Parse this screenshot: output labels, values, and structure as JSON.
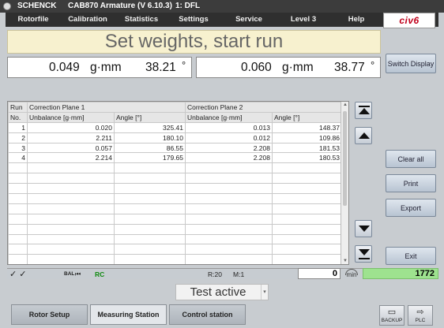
{
  "window": {
    "brand": "SCHENCK",
    "app_title": "CAB870 Armature (V 6.10.3)",
    "mode": "1: DFL"
  },
  "menu": [
    "Rotorfile",
    "Calibration",
    "Statistics",
    "Settings",
    "Service",
    "Level 3",
    "Help"
  ],
  "logo": "civ6",
  "banner": "Set weights, start run",
  "plane1_display": {
    "value": "0.049",
    "unit": "g·mm",
    "angle": "38.21",
    "angle_unit": "°"
  },
  "plane2_display": {
    "value": "0.060",
    "unit": "g·mm",
    "angle": "38.77",
    "angle_unit": "°"
  },
  "buttons": {
    "switch_display": "Switch Display",
    "clear_all": "Clear all",
    "print": "Print",
    "export": "Export",
    "exit": "Exit"
  },
  "table": {
    "h_run": "Run",
    "h_no": "No.",
    "h_plane1": "Correction Plane 1",
    "h_plane2": "Correction Plane 2",
    "h_unbalance": "Unbalance [g·mm]",
    "h_angle": "Angle [°]",
    "rows": [
      {
        "no": "1",
        "u1": "0.020",
        "a1": "325.41",
        "u2": "0.013",
        "a2": "148.37"
      },
      {
        "no": "2",
        "u1": "2.211",
        "a1": "180.10",
        "u2": "0.012",
        "a2": "109.86"
      },
      {
        "no": "3",
        "u1": "0.057",
        "a1": "86.55",
        "u2": "2.208",
        "a2": "181.53"
      },
      {
        "no": "4",
        "u1": "2.214",
        "a1": "179.65",
        "u2": "2.208",
        "a2": "180.53"
      }
    ]
  },
  "status": {
    "checks": "✓ ✓",
    "bal": "BAL",
    "rc": "RC",
    "r": "R:20",
    "m": "M:1",
    "counter": "0",
    "min_label": "min",
    "total": "1772"
  },
  "test_state": "Test active",
  "tabs": [
    "Rotor Setup",
    "Measuring Station",
    "Control station"
  ],
  "side_buttons": {
    "backup": "BACKUP",
    "plc": "PLC"
  },
  "colors": {
    "banner": "#f7f1cf",
    "green_counter": "#9ee28f",
    "menu_bg": "#2f2f2f"
  }
}
